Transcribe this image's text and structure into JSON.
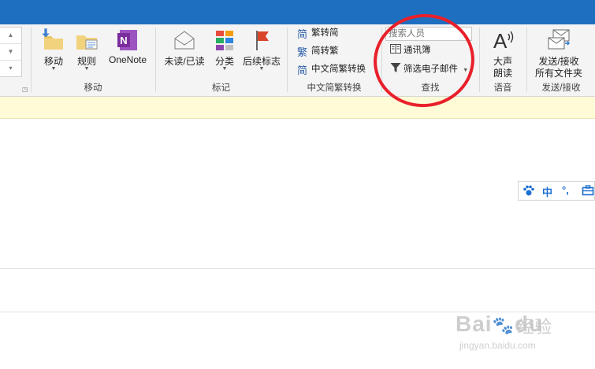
{
  "ribbon": {
    "move_group": {
      "move_label": "移动",
      "rules_label": "规则",
      "onenote_label": "OneNote",
      "group_label": "移动"
    },
    "tags_group": {
      "unread_label": "未读/已读",
      "categorize_label": "分类",
      "followup_label": "后续标志",
      "group_label": "标记"
    },
    "chinese_group": {
      "to_simplified": "繁转简",
      "to_traditional": "简转繁",
      "convert": "中文简繁转换",
      "group_label": "中文简繁转换",
      "icon_char_1": "简",
      "icon_char_2": "繁",
      "icon_char_3": "简"
    },
    "find_group": {
      "search_placeholder": "搜索人员",
      "address_book": "通讯簿",
      "filter_email": "筛选电子邮件",
      "group_label": "查找"
    },
    "speech_group": {
      "read_aloud_1": "大声",
      "read_aloud_2": "朗读",
      "group_label": "语音"
    },
    "send_group": {
      "send_receive_1": "发送/接收",
      "send_receive_2": "所有文件夹",
      "group_label": "发送/接收"
    }
  },
  "ime_toolbar": {
    "lang": "中",
    "punct": "°,"
  },
  "watermark": {
    "brand": "Bai",
    "brand2": "du",
    "product": "经验",
    "url": "jingyan.baidu.com"
  },
  "colors": {
    "titlebar": "#1f6fc0",
    "ribbon_bg": "#f4f4f4",
    "infobar": "#fffbd6",
    "highlight_circle": "#e8202a",
    "onenote": "#7b2d9e",
    "flag": "#d9462b"
  }
}
